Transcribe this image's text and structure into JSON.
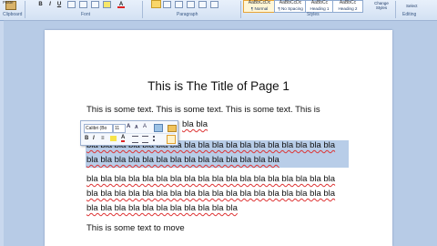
{
  "ribbon": {
    "paste_label": "Paste",
    "clipboard_group": "Clipboard",
    "font_group": "Font",
    "paragraph_group": "Paragraph",
    "styles_group": "Styles",
    "editing_group": "Editing",
    "bold": "B",
    "italic": "I",
    "underline": "U",
    "font_color": "A",
    "styles": [
      {
        "preview": "AaBbCcDc",
        "label": "¶ Normal"
      },
      {
        "preview": "AaBbCcDc",
        "label": "¶ No Spacing"
      },
      {
        "preview": "AaBbCc",
        "label": "Heading 1"
      },
      {
        "preview": "AaBbCc",
        "label": "Heading 2"
      }
    ],
    "change_styles": "Change Styles",
    "select": "Select"
  },
  "document": {
    "title": "This is The Title of Page 1",
    "para1_line1": "This is some text.  This is some text.  This is some text.  This is",
    "para1_line2_tail": "bla bla",
    "bla_line_a": "bla bla bla bla bla bla bla bla bla bla bla bla bla bla bla bla bla bla",
    "bla_line_b": "bla bla bla bla bla bla bla bla bla bla bla bla bla bla",
    "bla_line_c": "bla bla bla bla bla bla bla bla bla bla bla bla bla bla bla bla bla bla",
    "bla_line_d": "bla bla bla bla bla bla bla bla bla bla bla bla bla bla bla bla bla bla",
    "bla_line_e": "bla bla bla bla bla bla bla bla bla bla bla",
    "move_line": "This is some text to move"
  },
  "mini_toolbar": {
    "font_name": "Calibri (Bo",
    "font_size": "11",
    "bold": "B",
    "italic": "I",
    "underline": "≡",
    "font_color": "A"
  },
  "colors": {
    "selection": "#b8cde8",
    "squiggle": "#dd3333",
    "ribbon": "#d3e1f3"
  }
}
